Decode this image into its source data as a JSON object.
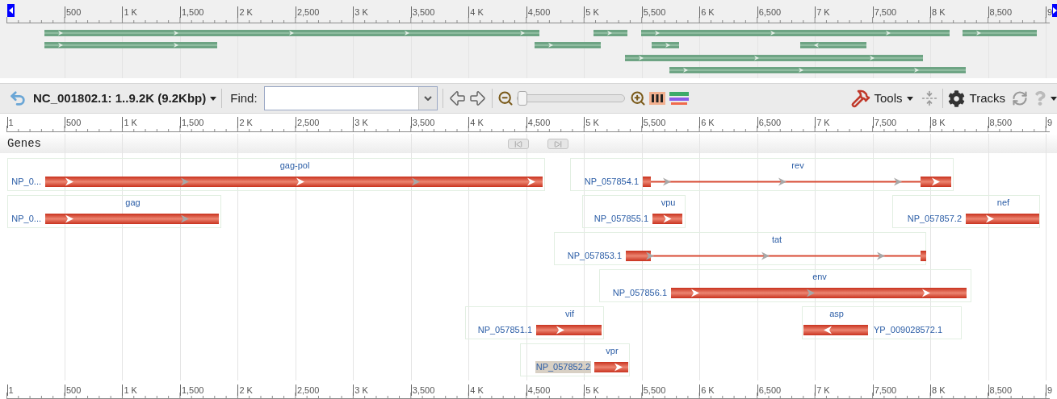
{
  "overview": {
    "ruler": {
      "labels": [
        "500",
        "1 K",
        "1,500",
        "2 K",
        "2,500",
        "3 K",
        "3,500",
        "4 K",
        "4,500",
        "5 K",
        "5,500",
        "6 K",
        "6,500",
        "7 K",
        "7,500",
        "8 K",
        "8,500",
        "9"
      ]
    }
  },
  "toolbar": {
    "sequence": "NC_001802.1: 1..9.2K (9.2Kbp)",
    "find_label": "Find:",
    "zoom": {
      "level": 0
    },
    "tools": "Tools",
    "tracks": "Tracks"
  },
  "ruler": {
    "start_label": "1",
    "labels": [
      "500",
      "1 K",
      "1,500",
      "2 K",
      "2,500",
      "3 K",
      "3,500",
      "4 K",
      "4,500",
      "5 K",
      "5,500",
      "6 K",
      "6,500",
      "7 K",
      "7,500",
      "8 K",
      "8,500",
      "9"
    ]
  },
  "track": {
    "title": "Genes",
    "genes": [
      {
        "name": "gag-pol",
        "accession": "NP_0...",
        "selected": false,
        "reverse": false,
        "kind": "single"
      },
      {
        "name": "gag",
        "accession": "NP_0...",
        "selected": false,
        "reverse": false,
        "kind": "single"
      },
      {
        "name": "rev",
        "accession": "NP_057854.1",
        "selected": false,
        "reverse": false,
        "kind": "spliced"
      },
      {
        "name": "vpu",
        "accession": "NP_057855.1",
        "selected": false,
        "reverse": false,
        "kind": "single"
      },
      {
        "name": "nef",
        "accession": "NP_057857.2",
        "selected": false,
        "reverse": false,
        "kind": "single"
      },
      {
        "name": "tat",
        "accession": "NP_057853.1",
        "selected": false,
        "reverse": false,
        "kind": "spliced"
      },
      {
        "name": "env",
        "accession": "NP_057856.1",
        "selected": false,
        "reverse": false,
        "kind": "single"
      },
      {
        "name": "vif",
        "accession": "NP_057851.1",
        "selected": false,
        "reverse": false,
        "kind": "single"
      },
      {
        "name": "asp",
        "accession": "YP_009028572.1",
        "selected": false,
        "reverse": true,
        "kind": "single"
      },
      {
        "name": "vpr",
        "accession": "NP_057852.2",
        "selected": true,
        "reverse": false,
        "kind": "single"
      }
    ]
  },
  "bottom_ruler": {
    "start_label": "1",
    "labels": [
      "500",
      "1 K",
      "1,500",
      "2 K",
      "2,500",
      "3 K",
      "3,500",
      "4 K",
      "4,500",
      "5 K",
      "5,500",
      "6 K",
      "6,500",
      "7 K",
      "7,500",
      "8 K",
      "8,500",
      "9"
    ]
  }
}
